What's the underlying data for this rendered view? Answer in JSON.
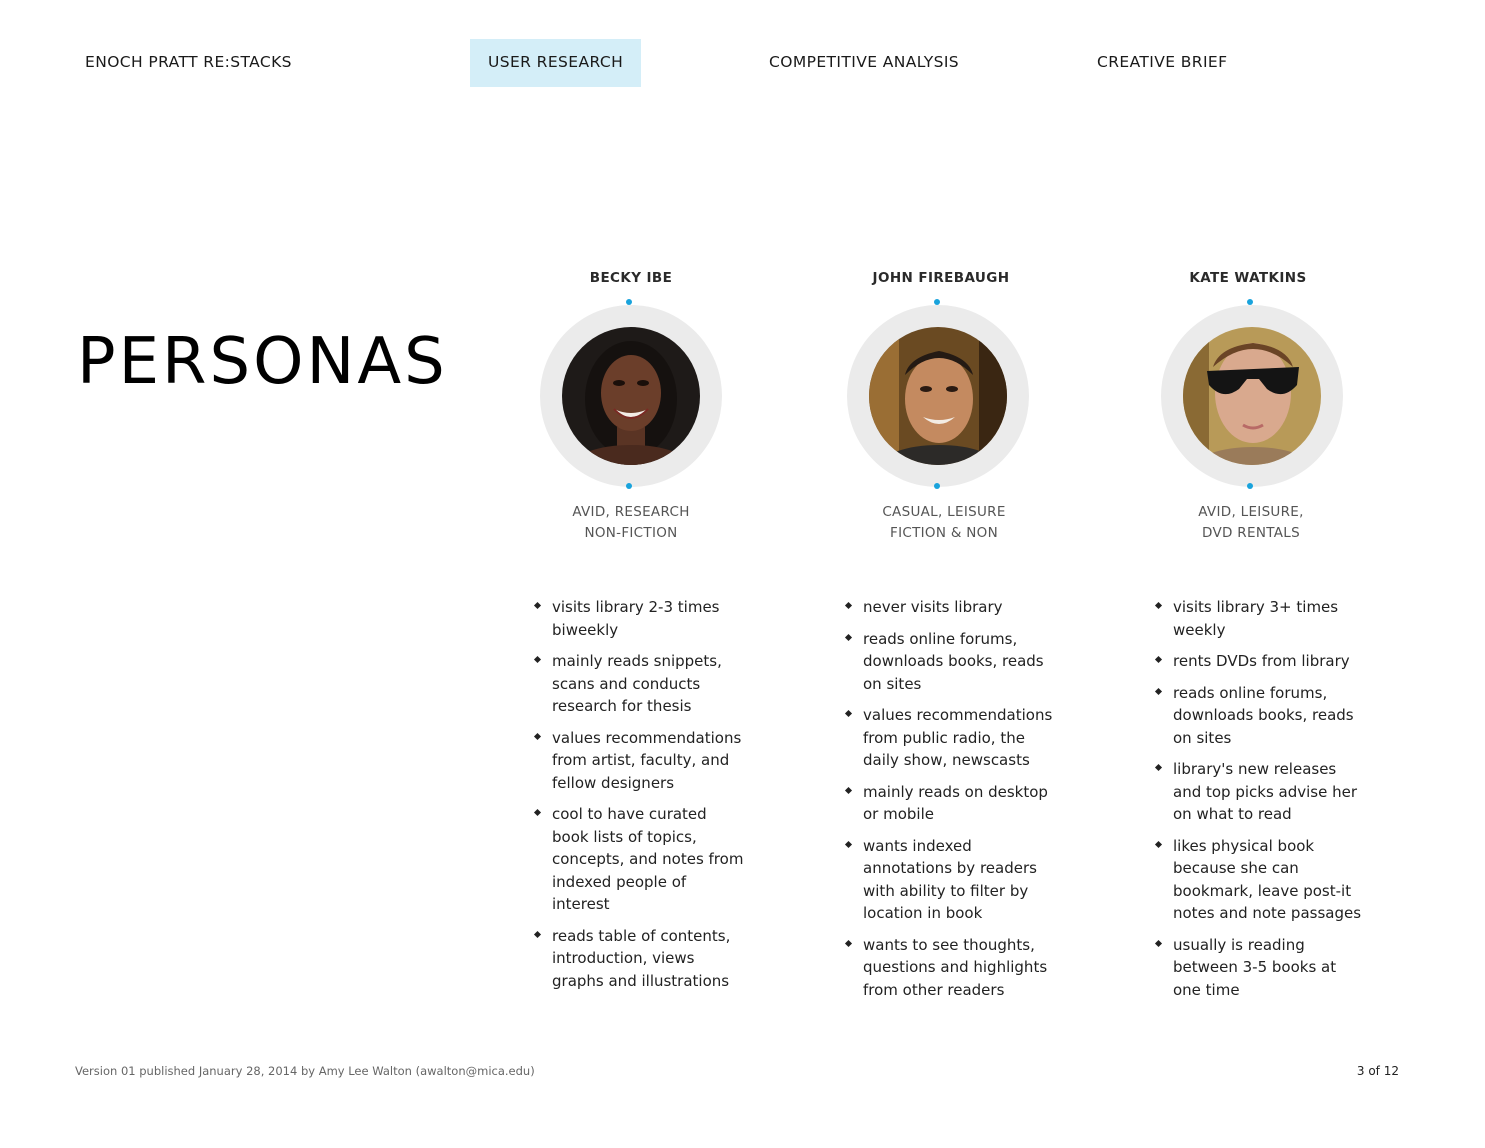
{
  "nav": {
    "items": [
      {
        "label": "ENOCH PRATT RE:STACKS",
        "active": false
      },
      {
        "label": "USER RESEARCH",
        "active": true
      },
      {
        "label": "COMPETITIVE ANALYSIS",
        "active": false
      },
      {
        "label": "CREATIVE BRIEF",
        "active": false
      }
    ]
  },
  "page": {
    "title": "PERSONAS"
  },
  "colors": {
    "accent_dot": "#19a3dc",
    "active_tab": "#d4eef8",
    "ring": "#ebebeb"
  },
  "personas": [
    {
      "name": "BECKY IBE",
      "photo_icon": "portrait-woman-icon",
      "tags": [
        "AVID, RESEARCH",
        "NON-FICTION"
      ],
      "traits": [
        "visits library 2-3 times biweekly",
        "mainly reads snippets, scans and conducts research for thesis",
        "values recommendations from artist, faculty, and fellow designers",
        "cool to have curated book lists of topics, concepts, and notes from indexed people of interest",
        "reads table of contents, introduction, views graphs and illustrations"
      ]
    },
    {
      "name": "JOHN FIREBAUGH",
      "photo_icon": "portrait-man-icon",
      "tags": [
        "CASUAL, LEISURE",
        "FICTION & NON"
      ],
      "traits": [
        "never visits library",
        "reads online forums, downloads books, reads on sites",
        "values recommendations from public radio, the daily show, newscasts",
        "mainly reads on desktop or mobile",
        "wants indexed annotations by readers with ability to filter by location in book",
        "wants to see thoughts, questions and highlights from other readers"
      ]
    },
    {
      "name": "KATE WATKINS",
      "photo_icon": "portrait-woman-sunglasses-icon",
      "tags": [
        "AVID, LEISURE,",
        "DVD RENTALS"
      ],
      "traits": [
        "visits library 3+ times weekly",
        "rents DVDs from library",
        "reads online forums, downloads books, reads on sites",
        "library's new releases and top picks advise her on what to read",
        "likes physical book because she can bookmark, leave post-it notes and note passages",
        "usually is reading between 3-5 books at one time"
      ]
    }
  ],
  "footer": {
    "credit": "Version 01 published January 28, 2014 by Amy Lee Walton (awalton@mica.edu)",
    "page_number": "3 of 12"
  }
}
